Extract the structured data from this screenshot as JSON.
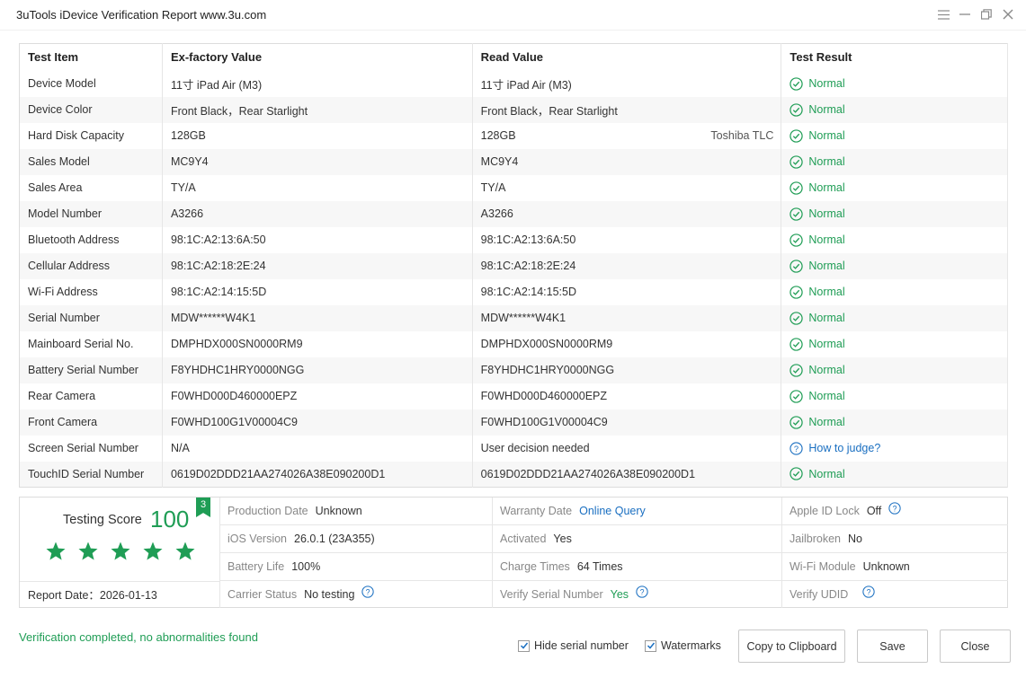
{
  "window": {
    "title": "3uTools iDevice Verification Report www.3u.com",
    "controls": [
      "menu-icon",
      "minimize-icon",
      "restore-icon",
      "close-icon"
    ]
  },
  "table": {
    "headers": [
      "Test Item",
      "Ex-factory Value",
      "Read Value",
      "Test Result"
    ],
    "rows": [
      {
        "item": "Device Model",
        "factory": "11寸 iPad Air (M3)",
        "read": "11寸 iPad Air (M3)",
        "extra": "",
        "result": "Normal",
        "status": "ok"
      },
      {
        "item": "Device Color",
        "factory": "Front Black，Rear Starlight",
        "read": "Front Black，Rear Starlight",
        "extra": "",
        "result": "Normal",
        "status": "ok"
      },
      {
        "item": "Hard Disk Capacity",
        "factory": "128GB",
        "read": "128GB",
        "extra": "Toshiba TLC",
        "result": "Normal",
        "status": "ok"
      },
      {
        "item": "Sales Model",
        "factory": "MC9Y4",
        "read": "MC9Y4",
        "extra": "",
        "result": "Normal",
        "status": "ok"
      },
      {
        "item": "Sales Area",
        "factory": "TY/A",
        "read": "TY/A",
        "extra": "",
        "result": "Normal",
        "status": "ok"
      },
      {
        "item": "Model Number",
        "factory": "A3266",
        "read": "A3266",
        "extra": "",
        "result": "Normal",
        "status": "ok"
      },
      {
        "item": "Bluetooth Address",
        "factory": "98:1C:A2:13:6A:50",
        "read": "98:1C:A2:13:6A:50",
        "extra": "",
        "result": "Normal",
        "status": "ok"
      },
      {
        "item": "Cellular Address",
        "factory": "98:1C:A2:18:2E:24",
        "read": "98:1C:A2:18:2E:24",
        "extra": "",
        "result": "Normal",
        "status": "ok"
      },
      {
        "item": "Wi-Fi Address",
        "factory": "98:1C:A2:14:15:5D",
        "read": "98:1C:A2:14:15:5D",
        "extra": "",
        "result": "Normal",
        "status": "ok"
      },
      {
        "item": "Serial Number",
        "factory": "MDW******W4K1",
        "read": "MDW******W4K1",
        "extra": "",
        "result": "Normal",
        "status": "ok"
      },
      {
        "item": "Mainboard Serial No.",
        "factory": "DMPHDX000SN0000RM9",
        "read": "DMPHDX000SN0000RM9",
        "extra": "",
        "result": "Normal",
        "status": "ok"
      },
      {
        "item": "Battery Serial Number",
        "factory": "F8YHDHC1HRY0000NGG",
        "read": "F8YHDHC1HRY0000NGG",
        "extra": "",
        "result": "Normal",
        "status": "ok"
      },
      {
        "item": "Rear Camera",
        "factory": "F0WHD000D460000EPZ",
        "read": "F0WHD000D460000EPZ",
        "extra": "",
        "result": "Normal",
        "status": "ok"
      },
      {
        "item": "Front Camera",
        "factory": "F0WHD100G1V00004C9",
        "read": "F0WHD100G1V00004C9",
        "extra": "",
        "result": "Normal",
        "status": "ok"
      },
      {
        "item": "Screen Serial Number",
        "factory": "N/A",
        "read": "User decision needed",
        "extra": "",
        "result": "How to judge?",
        "status": "question"
      },
      {
        "item": "TouchID Serial Number",
        "factory": "0619D02DDD21AA274026A38E090200D1",
        "read": "0619D02DDD21AA274026A38E090200D1",
        "extra": "",
        "result": "Normal",
        "status": "ok"
      }
    ]
  },
  "summary": {
    "score_label": "Testing Score",
    "score": "100",
    "badge": "3",
    "stars": 5,
    "report_date_label": "Report Date：",
    "report_date": "2026-01-13",
    "production_date_label": "Production Date",
    "production_date": "Unknown",
    "warranty_date_label": "Warranty Date",
    "warranty_date": "Online Query",
    "apple_id_lock_label": "Apple ID Lock",
    "apple_id_lock": "Off",
    "ios_version_label": "iOS Version",
    "ios_version": "26.0.1 (23A355)",
    "activated_label": "Activated",
    "activated": "Yes",
    "jailbroken_label": "Jailbroken",
    "jailbroken": "No",
    "battery_life_label": "Battery Life",
    "battery_life": "100%",
    "charge_times_label": "Charge Times",
    "charge_times": "64 Times",
    "wifi_module_label": "Wi-Fi Module",
    "wifi_module": "Unknown",
    "carrier_status_label": "Carrier Status",
    "carrier_status": "No testing",
    "verify_serial_label": "Verify Serial Number",
    "verify_serial": "Yes",
    "verify_udid_label": "Verify UDID"
  },
  "footer": {
    "status": "Verification completed, no abnormalities found",
    "hide_serial_label": "Hide serial number",
    "hide_serial_checked": true,
    "watermarks_label": "Watermarks",
    "watermarks_checked": true,
    "copy_button": "Copy to Clipboard",
    "save_button": "Save",
    "close_button": "Close"
  },
  "colors": {
    "accent_green": "#1f9d55",
    "link_blue": "#1a6fc1",
    "border": "#dcdcdc"
  }
}
